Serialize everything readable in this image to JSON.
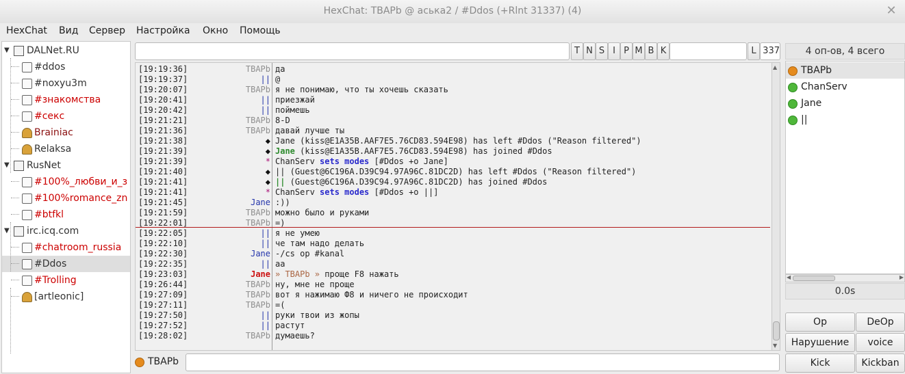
{
  "window": {
    "title": "HexChat: TBAPb @ аська2 / #Ddos (+Rlnt 31337) (4)",
    "close_glyph": "✕"
  },
  "menu": [
    "HexChat",
    "Вид",
    "Сервер",
    "Настройка",
    "Окно",
    "Помощь"
  ],
  "tree": [
    {
      "label": "DALNet.RU",
      "type": "server"
    },
    {
      "label": "#ddos",
      "type": "channel",
      "color": "#333333"
    },
    {
      "label": "#noxyu3m",
      "type": "channel",
      "color": "#333333"
    },
    {
      "label": "#знакомства",
      "type": "channel",
      "color": "#cc0000"
    },
    {
      "label": "#секс",
      "type": "channel",
      "color": "#cc0000"
    },
    {
      "label": "Brainiac",
      "type": "query",
      "color": "#8b1010"
    },
    {
      "label": "Relaksa",
      "type": "query",
      "color": "#333333"
    },
    {
      "label": "RusNet",
      "type": "server"
    },
    {
      "label": "#100%_любви_и_з",
      "type": "channel",
      "color": "#cc0000"
    },
    {
      "label": "#100%romance_zn",
      "type": "channel",
      "color": "#cc0000"
    },
    {
      "label": "#btfkl",
      "type": "channel",
      "color": "#cc0000"
    },
    {
      "label": "irc.icq.com",
      "type": "server"
    },
    {
      "label": "#chatroom_russia",
      "type": "channel",
      "color": "#cc0000"
    },
    {
      "label": "#Ddos",
      "type": "channel",
      "color": "#333333",
      "selected": true
    },
    {
      "label": "#Trolling",
      "type": "channel",
      "color": "#cc0000"
    },
    {
      "label": "[artleonic]",
      "type": "query",
      "color": "#333333"
    }
  ],
  "modes": [
    "T",
    "N",
    "S",
    "I",
    "P",
    "M",
    "B",
    "K",
    "L"
  ],
  "channel_limit": "337",
  "topic": "",
  "chat": [
    {
      "ts": "[19:19:36]",
      "nick": "TBAPb",
      "nc": "gray",
      "msg": "да"
    },
    {
      "ts": "[19:19:37]",
      "nick": "||",
      "nc": "bar",
      "msg": "@"
    },
    {
      "ts": "[19:20:07]",
      "nick": "TBAPb",
      "nc": "gray",
      "msg": "я не понимаю, что ты хочешь сказать"
    },
    {
      "ts": "[19:20:41]",
      "nick": "||",
      "nc": "bar",
      "msg": "приезжай"
    },
    {
      "ts": "[19:20:42]",
      "nick": "||",
      "nc": "bar",
      "msg": "поймешь"
    },
    {
      "ts": "[19:21:21]",
      "nick": "TBAPb",
      "nc": "gray",
      "msg": "8-D"
    },
    {
      "ts": "[19:21:36]",
      "nick": "TBAPb",
      "nc": "gray",
      "msg": "давай лучше ты"
    },
    {
      "ts": "[19:21:38]",
      "nick": "◆",
      "nc": "dia",
      "msg": "Jane (kiss@E1A35B.AAF7E5.76CD83.594E98) has left #Ddos (\"Reason filtered\")",
      "mc": "left"
    },
    {
      "ts": "[19:21:39]",
      "nick": "◆",
      "nc": "dia",
      "msg_bold": "Jane",
      "msg": " (kiss@E1A35B.AAF7E5.76CD83.594E98) has joined #Ddos",
      "mc": "join"
    },
    {
      "ts": "[19:21:39]",
      "nick": "*",
      "nc": "star",
      "msg_pre": "ChanServ ",
      "msg_bold": "sets modes",
      "msg": "  [#Ddos +o Jane]",
      "mc": "mode"
    },
    {
      "ts": "[19:21:40]",
      "nick": "◆",
      "nc": "dia",
      "msg": "|| (Guest@6C196A.D39C94.97A96C.81DC2D) has left #Ddos (\"Reason filtered\")",
      "mc": "left"
    },
    {
      "ts": "[19:21:41]",
      "nick": "◆",
      "nc": "dia",
      "msg_bold": "||",
      "msg": " (Guest@6C196A.D39C94.97A96C.81DC2D) has joined #Ddos",
      "mc": "join"
    },
    {
      "ts": "[19:21:41]",
      "nick": "*",
      "nc": "star",
      "msg_pre": "ChanServ ",
      "msg_bold": "sets modes",
      "msg": "  [#Ddos +o ||]",
      "mc": "mode"
    },
    {
      "ts": "[19:21:45]",
      "nick": "Jane",
      "nc": "blue",
      "msg": ":))"
    },
    {
      "ts": "[19:21:59]",
      "nick": "TBAPb",
      "nc": "gray",
      "msg": "можно было и руками"
    },
    {
      "ts": "[19:22:01]",
      "nick": "TBAPb",
      "nc": "gray",
      "msg": "=)"
    },
    {
      "ts": "[19:22:05]",
      "nick": "||",
      "nc": "bar",
      "msg": "я не умею"
    },
    {
      "ts": "[19:22:10]",
      "nick": "||",
      "nc": "bar",
      "msg": "че там надо делать"
    },
    {
      "ts": "[19:22:30]",
      "nick": "Jane",
      "nc": "blue",
      "msg": "-/cs op #kanal"
    },
    {
      "ts": "[19:22:35]",
      "nick": "||",
      "nc": "bar",
      "msg": "аа"
    },
    {
      "ts": "[19:23:03]",
      "nick": "Jane",
      "nc": "jane-hl",
      "msg_hl": "» TBAPb »",
      "msg": " проще F8 нажать",
      "mc": "hl"
    },
    {
      "ts": "[19:26:44]",
      "nick": "TBAPb",
      "nc": "gray",
      "msg": "ну, мне не проще"
    },
    {
      "ts": "[19:27:09]",
      "nick": "TBAPb",
      "nc": "gray",
      "msg": "вот я нажимаю Ф8 и ничего не происходит"
    },
    {
      "ts": "[19:27:11]",
      "nick": "TBAPb",
      "nc": "gray",
      "msg": "=("
    },
    {
      "ts": "[19:27:50]",
      "nick": "||",
      "nc": "bar",
      "msg": "руки твои из жопы"
    },
    {
      "ts": "[19:27:52]",
      "nick": "||",
      "nc": "bar",
      "msg": "растут"
    },
    {
      "ts": "[19:28:02]",
      "nick": "TBAPb",
      "nc": "gray",
      "msg": "думаешь?"
    }
  ],
  "input": {
    "nick": "TBAPb",
    "value": ""
  },
  "users": {
    "count_label": "4 оп-ов, 4 всего",
    "list": [
      {
        "name": "TBAPb",
        "status": "orange",
        "selected": true
      },
      {
        "name": "ChanServ",
        "status": "green"
      },
      {
        "name": "Jane",
        "status": "green"
      },
      {
        "name": "||",
        "status": "green"
      }
    ],
    "status_colors": {
      "orange": "#e58b1e",
      "green": "#4fb73a"
    }
  },
  "lag": "0.0s",
  "actions": [
    "Op",
    "DeOp",
    "Нарушение",
    "voice",
    "Kick",
    "Kickban"
  ]
}
